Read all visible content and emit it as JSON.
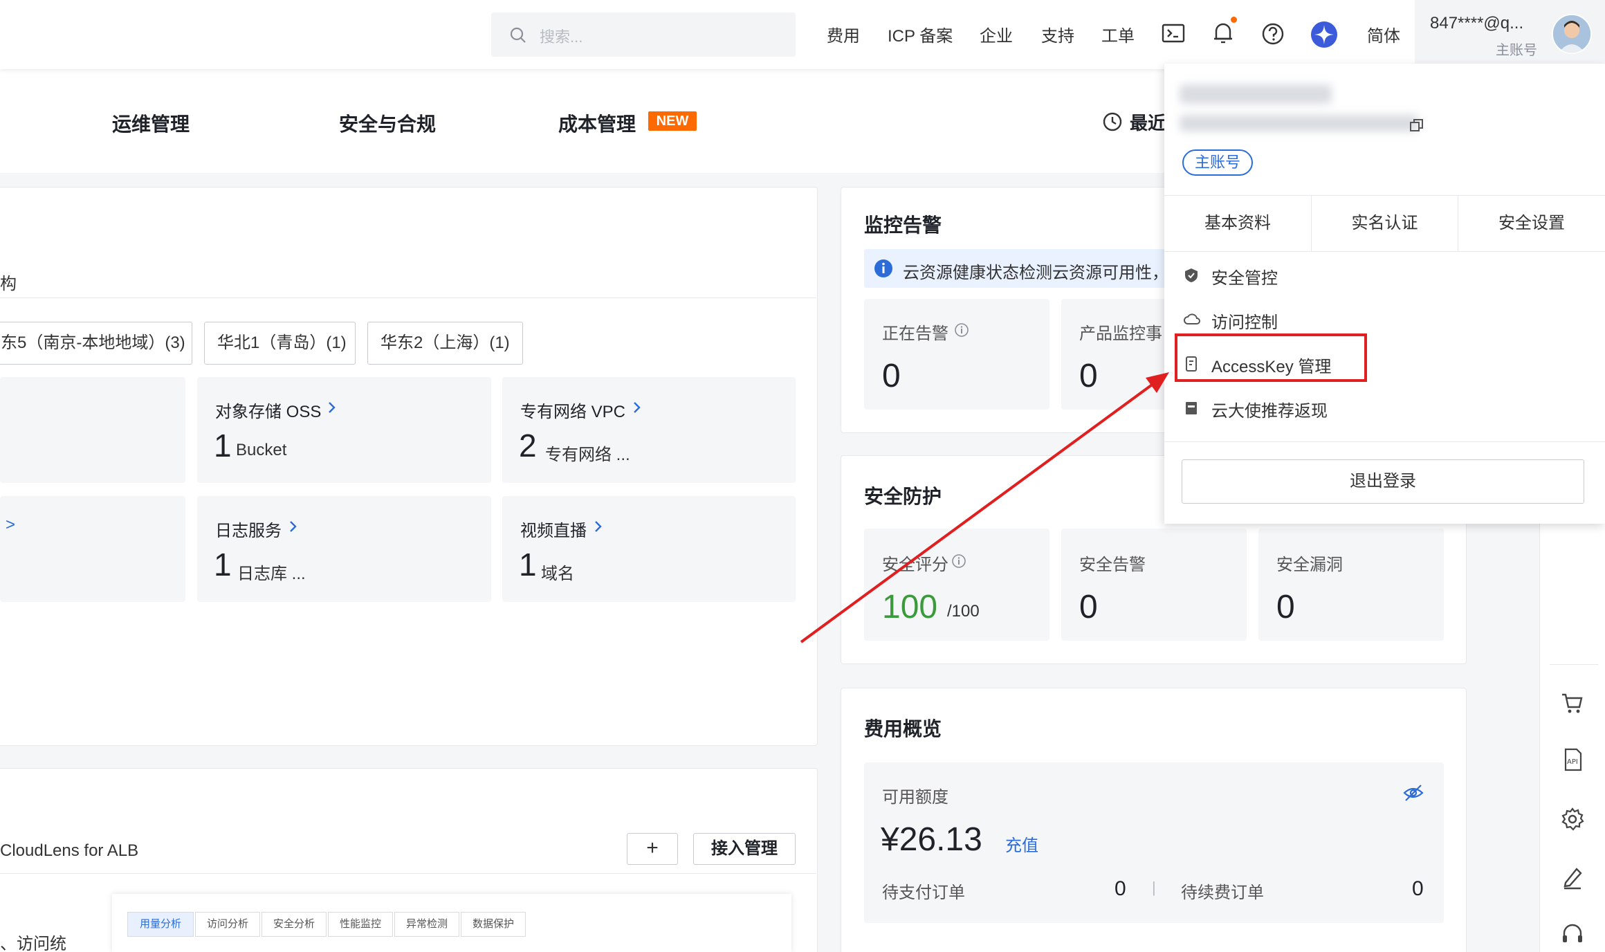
{
  "header": {
    "search_placeholder": "搜索...",
    "nav": [
      "费用",
      "ICP 备案",
      "企业",
      "支持",
      "工单"
    ],
    "lang": "简体",
    "account_name": "847****@q...",
    "account_role": "主账号"
  },
  "tabs": {
    "items": [
      "运维管理",
      "安全与合规",
      "成本管理"
    ],
    "new_badge": "NEW",
    "recent": "最近"
  },
  "resources": {
    "partial_label": "构",
    "regions": [
      "东5（南京-本地地域）(3)",
      "华北1（青岛）(1)",
      "华东2（上海）(1)"
    ],
    "tiles": [
      {
        "title": "对象存储 OSS",
        "count": "1",
        "unit": "Bucket"
      },
      {
        "title": "专有网络 VPC",
        "count": "2",
        "unit": "专有网络 ..."
      },
      {
        "title": "日志服务",
        "count": "1",
        "unit": "日志库 ..."
      },
      {
        "title": "视频直播",
        "count": "1",
        "unit": "域名"
      }
    ],
    "left_chevron": ">"
  },
  "cloudlens": {
    "title": "CloudLens for ALB",
    "add": "+",
    "manage": "接入管理",
    "partial_text": "、访问统",
    "preview_tabs": [
      "用量分析",
      "访问分析",
      "安全分析",
      "性能监控",
      "异常检测",
      "数据保护"
    ]
  },
  "monitor": {
    "title": "监控告警",
    "notice": "云资源健康状态检测云资源可用性，",
    "stats": [
      {
        "label": "正在告警",
        "value": "0"
      },
      {
        "label": "产品监控事",
        "value": "0"
      }
    ]
  },
  "security": {
    "title": "安全防护",
    "score_label": "安全评分",
    "score": "100",
    "score_max": "/100",
    "alert_label": "安全告警",
    "alert_value": "0",
    "vuln_label": "安全漏洞",
    "vuln_value": "0"
  },
  "cost": {
    "title": "费用概览",
    "balance_label": "可用额度",
    "balance": "¥26.13",
    "recharge": "充值",
    "pending_pay_label": "待支付订单",
    "pending_pay": "0",
    "divider": "|",
    "pending_renew_label": "待续费订单",
    "pending_renew": "0"
  },
  "dropdown": {
    "role_tag": "主账号",
    "tabs": [
      "基本资料",
      "实名认证",
      "安全设置"
    ],
    "items": [
      "安全管控",
      "访问控制",
      "AccessKey 管理",
      "云大使推荐返现"
    ],
    "logout": "退出登录"
  },
  "colors": {
    "accent": "#ff6a00",
    "link": "#2b6cd9",
    "highlight": "#e02020",
    "score_green": "#3b9a3b"
  },
  "icons": [
    "search-icon",
    "terminal-icon",
    "bell-icon",
    "help-icon",
    "ai-assistant-icon",
    "clock-icon",
    "info-icon",
    "shield-icon",
    "cloud-icon",
    "key-icon",
    "gift-icon",
    "copy-icon",
    "eye-off-icon",
    "cart-icon",
    "api-icon",
    "gear-icon",
    "edit-icon",
    "headset-icon"
  ]
}
